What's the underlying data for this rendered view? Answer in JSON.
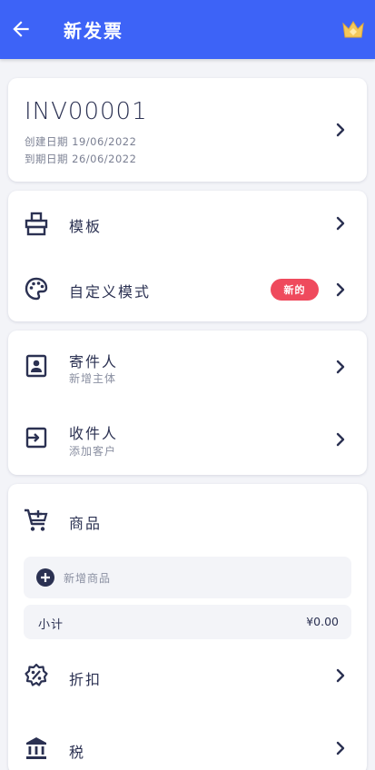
{
  "appbar": {
    "title": "新发票"
  },
  "invoice": {
    "number": "INV00001",
    "created": "创建日期 19/06/2022",
    "due": "到期日期 26/06/2022"
  },
  "design": {
    "template_label": "模板",
    "custom_label": "自定义模式",
    "custom_badge": "新的"
  },
  "parties": {
    "sender_label": "寄件人",
    "sender_sub": "新增主体",
    "receiver_label": "收件人",
    "receiver_sub": "添加客户"
  },
  "items": {
    "title": "商品",
    "add_placeholder": "新增商品",
    "subtotal_label": "小计",
    "subtotal_value": "¥0.00",
    "discount_label": "折扣",
    "tax_label": "税"
  },
  "colors": {
    "primary": "#3d63f7",
    "badge": "#ef4a5d",
    "ink": "#2b3152",
    "background": "#f3f4f8"
  },
  "icons": {
    "back": "arrow-left-icon",
    "premium": "crown-icon",
    "template": "template-icon",
    "custom": "palette-icon",
    "sender": "contact-card-icon",
    "receiver": "login-box-icon",
    "items": "cart-add-icon",
    "add": "plus-circle-icon",
    "discount": "discount-badge-icon",
    "tax": "bank-icon",
    "chevron": "chevron-right-icon"
  }
}
